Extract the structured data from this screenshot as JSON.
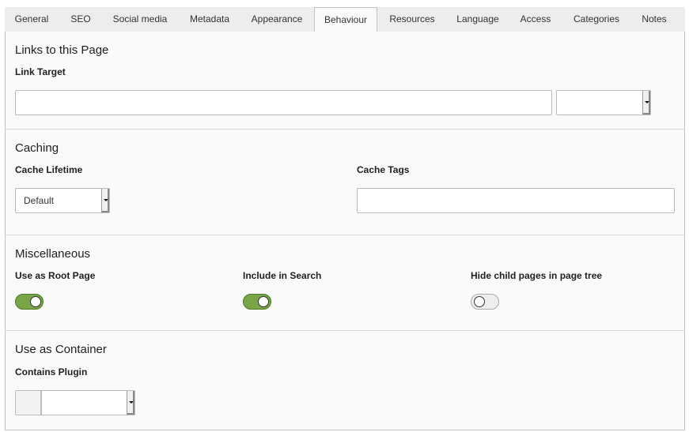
{
  "tabs": [
    {
      "label": "General",
      "active": false
    },
    {
      "label": "SEO",
      "active": false
    },
    {
      "label": "Social media",
      "active": false
    },
    {
      "label": "Metadata",
      "active": false
    },
    {
      "label": "Appearance",
      "active": false
    },
    {
      "label": "Behaviour",
      "active": true
    },
    {
      "label": "Resources",
      "active": false
    },
    {
      "label": "Language",
      "active": false
    },
    {
      "label": "Access",
      "active": false
    },
    {
      "label": "Categories",
      "active": false
    },
    {
      "label": "Notes",
      "active": false
    }
  ],
  "links": {
    "title": "Links to this Page",
    "link_target_label": "Link Target",
    "link_target_value": "",
    "link_target_select": ""
  },
  "caching": {
    "title": "Caching",
    "lifetime_label": "Cache Lifetime",
    "lifetime_value": "Default",
    "tags_label": "Cache Tags",
    "tags_value": ""
  },
  "misc": {
    "title": "Miscellaneous",
    "root_label": "Use as Root Page",
    "root_on": true,
    "search_label": "Include in Search",
    "search_on": true,
    "hide_label": "Hide child pages in page tree",
    "hide_on": false
  },
  "container": {
    "title": "Use as Container",
    "plugin_label": "Contains Plugin",
    "plugin_value": ""
  },
  "colors": {
    "toggle_on": "#79a548",
    "panel_bg": "#fafafa",
    "tab_bar_bg": "#ededed"
  }
}
